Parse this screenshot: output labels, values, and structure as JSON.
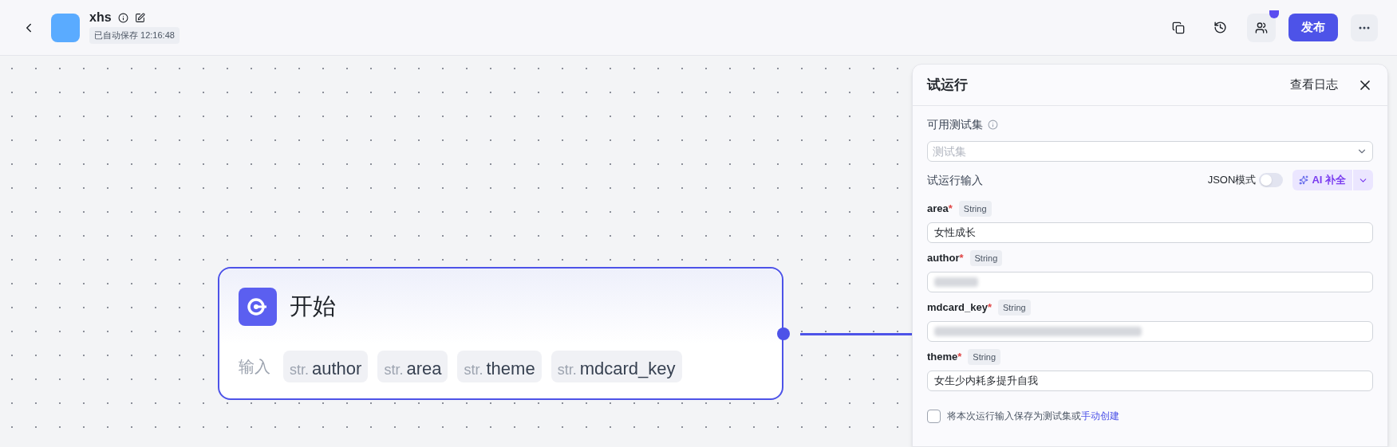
{
  "header": {
    "title": "xhs",
    "autosave": "已自动保存 12:16:48",
    "publish_button": "发布",
    "collaborator_badge": true
  },
  "start_node": {
    "title": "开始",
    "input_label": "输入",
    "selected": true,
    "params": [
      {
        "type": "str.",
        "name": "author"
      },
      {
        "type": "str.",
        "name": "area"
      },
      {
        "type": "str.",
        "name": "theme"
      },
      {
        "type": "str.",
        "name": "mdcard_key"
      }
    ]
  },
  "test_panel": {
    "title": "试运行",
    "log_link": "查看日志",
    "test_set_label": "可用测试集",
    "test_set_placeholder": "测试集",
    "input_section": "试运行输入",
    "json_mode_label": "JSON模式",
    "json_mode": false,
    "ai_button": "AI 补全",
    "fields": [
      {
        "name": "area",
        "required_mark": "*",
        "type": "String",
        "value": "女性成长"
      },
      {
        "name": "author",
        "required_mark": "*",
        "type": "String",
        "redacted": true
      },
      {
        "name": "mdcard_key",
        "required_mark": "*",
        "type": "String",
        "redacted": true
      },
      {
        "name": "theme",
        "required_mark": "*",
        "type": "String",
        "value": "女生少内耗多提升自我"
      }
    ],
    "save_checkbox": {
      "checked": false,
      "text": "将本次运行输入保存为测试集或",
      "link": "手动创建"
    }
  }
}
